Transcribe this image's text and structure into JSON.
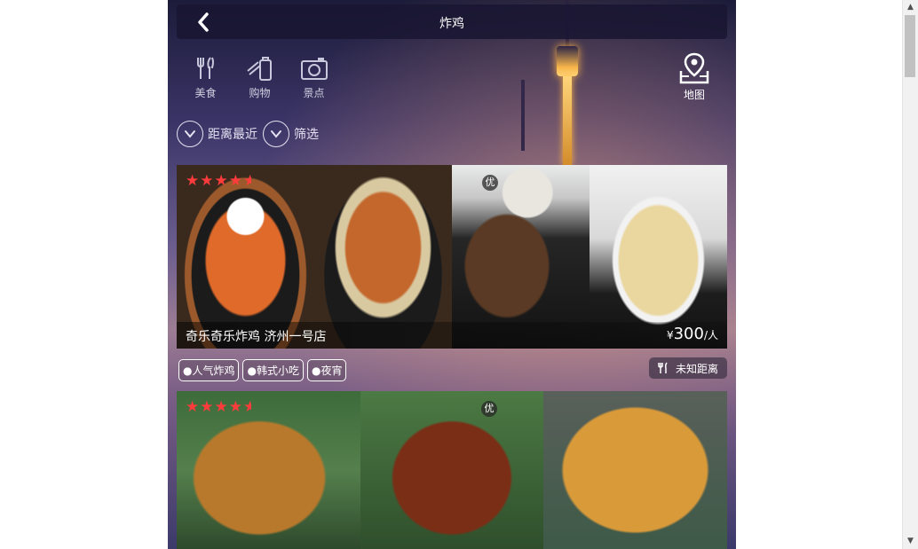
{
  "header": {
    "title": "炸鸡",
    "back_icon": "chevron-left-icon"
  },
  "categories": [
    {
      "label": "美食",
      "icon": "utensils-icon"
    },
    {
      "label": "购物",
      "icon": "shopping-bag-icon"
    },
    {
      "label": "景点",
      "icon": "camera-icon"
    }
  ],
  "map_button": {
    "label": "地图",
    "icon": "map-pin-icon"
  },
  "filters": [
    {
      "label": "距离最近",
      "icon": "chevron-down-circle-icon"
    },
    {
      "label": "筛选",
      "icon": "chevron-down-circle-icon"
    }
  ],
  "listings": [
    {
      "name": "奇乐奇乐炸鸡 济州一号店",
      "price_symbol": "¥",
      "price": "300",
      "price_unit": "/人",
      "rating": 4.5,
      "badge": "优",
      "tags": [
        "●人气炸鸡",
        "●韩式小吃",
        "●夜宵"
      ],
      "distance": "未知距离"
    },
    {
      "rating": 4.5,
      "badge": "优"
    }
  ],
  "colors": {
    "star": "#ff3b3b",
    "header_bg": "#19163280"
  }
}
